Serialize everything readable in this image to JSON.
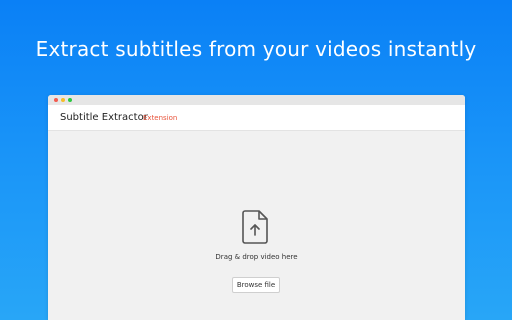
{
  "banner": {
    "headline": "Extract subtitles from your videos instantly"
  },
  "window": {
    "app_name": "Subtitle Extractor",
    "app_tag": "Extension",
    "dropzone": {
      "label": "Drag & drop video here",
      "browse_label": "Browse file",
      "icon": "file-upload-icon"
    }
  },
  "colors": {
    "background_top": "#0a80f6",
    "background_bottom": "#28a6f7",
    "tag_color": "#e8533b"
  }
}
